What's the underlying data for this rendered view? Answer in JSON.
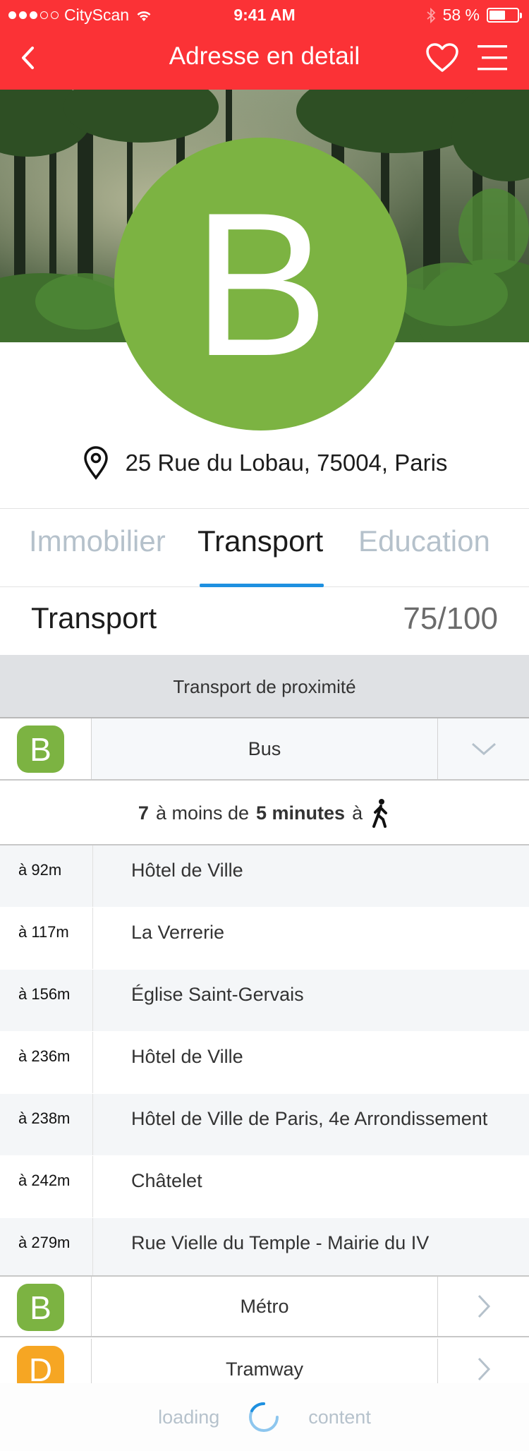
{
  "status_bar": {
    "carrier": "CityScan",
    "time": "9:41 AM",
    "battery": "58 %",
    "battery_level": 0.58
  },
  "header": {
    "title": "Adresse en detail"
  },
  "hero": {
    "badge_letter": "B",
    "badge_color": "#7cb342"
  },
  "address": {
    "text": "25 Rue du Lobau, 75004, Paris"
  },
  "tabs": [
    {
      "label": "Immobilier",
      "active": false
    },
    {
      "label": "Transport",
      "active": true
    },
    {
      "label": "Education",
      "active": false
    }
  ],
  "score": {
    "title": "Transport",
    "value": "75/100"
  },
  "section": {
    "label": "Transport de proximité"
  },
  "modes": [
    {
      "letter": "B",
      "color": "#7cb342",
      "label": "Bus",
      "state": "expanded",
      "icon": "chevron-down-icon"
    },
    {
      "letter": "B",
      "color": "#7cb342",
      "label": "Métro",
      "state": "collapsed",
      "icon": "chevron-right-icon"
    },
    {
      "letter": "D",
      "color": "#f6a623",
      "label": "Tramway",
      "state": "collapsed",
      "icon": "chevron-right-icon"
    }
  ],
  "summary": {
    "count": "7",
    "pre": "à moins de",
    "minutes": "5 minutes",
    "post": "à",
    "icon": "walking-person-icon"
  },
  "stops": [
    {
      "distance": "à 92m",
      "name": "Hôtel de Ville"
    },
    {
      "distance": "à 117m",
      "name": "La Verrerie"
    },
    {
      "distance": "à 156m",
      "name": "Église Saint-Gervais"
    },
    {
      "distance": "à 236m",
      "name": "Hôtel de Ville"
    },
    {
      "distance": "à 238m",
      "name": "Hôtel de Ville de Paris, 4e Arrondissement"
    },
    {
      "distance": "à 242m",
      "name": "Châtelet"
    },
    {
      "distance": "à 279m",
      "name": "Rue Vielle du Temple - Mairie du IV"
    }
  ],
  "loading": {
    "left": "loading",
    "right": "content"
  },
  "colors": {
    "accent_red": "#fb3236",
    "tab_underline": "#1e90e0",
    "inactive_tab": "#b5c1cb"
  }
}
